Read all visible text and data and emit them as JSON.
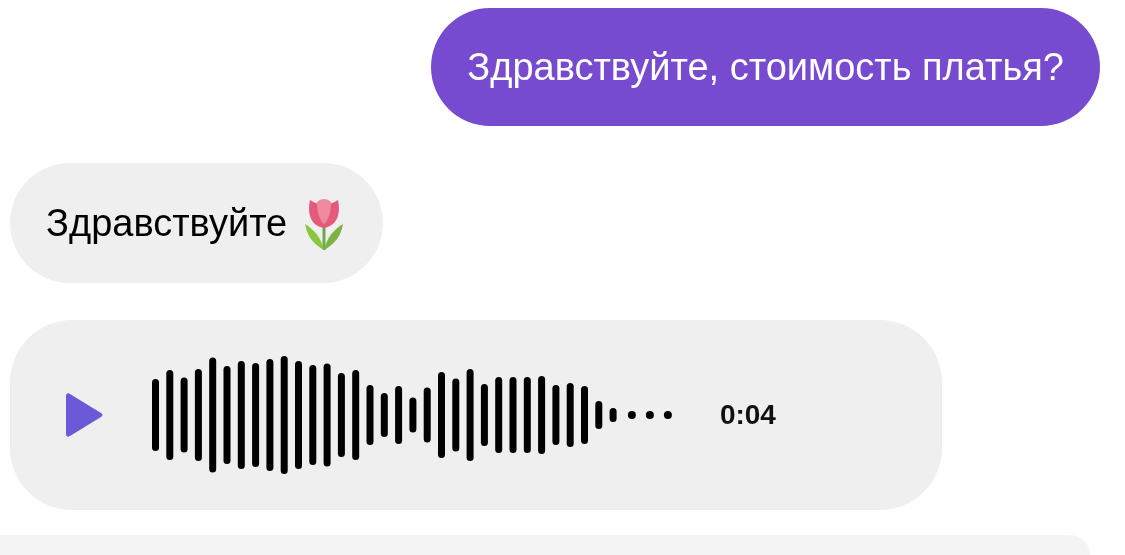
{
  "messages": [
    {
      "kind": "outgoing",
      "text": "Здравствуйте, стоимость платья?"
    },
    {
      "kind": "incoming",
      "text": "Здравствуйте",
      "flower_icon": true
    },
    {
      "kind": "voice",
      "duration": "0:04"
    },
    {
      "kind": "partial"
    }
  ]
}
